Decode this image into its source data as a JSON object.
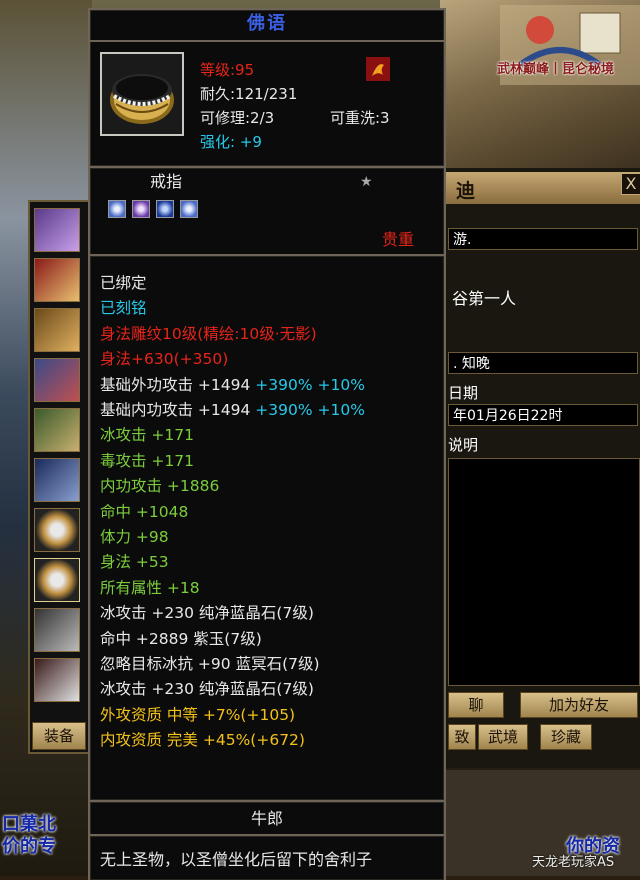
{
  "tooltip": {
    "title": "佛语",
    "level": "等级:95",
    "durability": "耐久:121/231",
    "repairable": "可修理:2/3",
    "rewashable": "可重洗:3",
    "enhance_label": "强化:",
    "enhance_value": "+9",
    "item_type": "戒指",
    "quality": "贵重",
    "lines": [
      {
        "text": "已绑定",
        "color": "#e8e8e8"
      },
      {
        "text": "已刻铭",
        "color": "#27c9ea"
      },
      {
        "text": "身法雕纹10级(精绘:10级·无影)",
        "color": "#e6241a"
      },
      {
        "text": "身法+630(+350)",
        "color": "#e6241a"
      },
      {
        "text": "基础外功攻击 +1494",
        "extra": [
          {
            "text": " +390%",
            "color": "#27c9ea"
          },
          {
            "text": " +10%",
            "color": "#27c9ea"
          }
        ],
        "color": "#e8e8e8"
      },
      {
        "text": "基础内功攻击 +1494",
        "extra": [
          {
            "text": " +390%",
            "color": "#27c9ea"
          },
          {
            "text": " +10%",
            "color": "#27c9ea"
          }
        ],
        "color": "#e8e8e8"
      },
      {
        "text": "冰攻击 +171",
        "color": "#7ccd3d"
      },
      {
        "text": "毒攻击 +171",
        "color": "#7ccd3d"
      },
      {
        "text": "内功攻击 +1886",
        "color": "#7ccd3d"
      },
      {
        "text": "命中 +1048",
        "color": "#7ccd3d"
      },
      {
        "text": "体力 +98",
        "color": "#7ccd3d"
      },
      {
        "text": "身法 +53",
        "color": "#7ccd3d"
      },
      {
        "text": "所有属性 +18",
        "color": "#7ccd3d"
      },
      {
        "text": "冰攻击 +230 纯净蓝晶石(7级)",
        "color": "#e8e8e8"
      },
      {
        "text": "命中 +2889 紫玉(7级)",
        "color": "#e8e8e8"
      },
      {
        "text": "忽略目标冰抗 +90 蓝冥石(7级)",
        "color": "#e8e8e8"
      },
      {
        "text": "冰攻击 +230 纯净蓝晶石(7级)",
        "color": "#e8e8e8"
      },
      {
        "text": "外攻资质  中等 +7%(+105)",
        "color": "#f2c21a"
      },
      {
        "text": "内攻资质  完美 +45%(+672)",
        "color": "#f2c21a"
      }
    ],
    "maker": "牛郎",
    "description": "无上圣物，以圣僧坐化后留下的舍利子"
  },
  "background_window": {
    "title_fragment": "迪",
    "close": "X",
    "field1": "游.",
    "field2": "谷第一人",
    "field3": ". 知晚",
    "label_date": "日期",
    "date_value": "年01月26日22时",
    "label_desc": "说明",
    "btn_chat": "聊",
    "btn_add_friend": "加为好友",
    "btn_tab1": "致",
    "btn_tab2": "武境",
    "btn_tab3": "珍藏"
  },
  "equip_strip": {
    "tab_label": "装备"
  },
  "scene": {
    "promo_text": "武林巅峰丨昆仑秘境",
    "left_text_1": "口菓北",
    "left_text_2": "价的专",
    "right_text": "你的资",
    "watermark": "天龙老玩家AS"
  }
}
